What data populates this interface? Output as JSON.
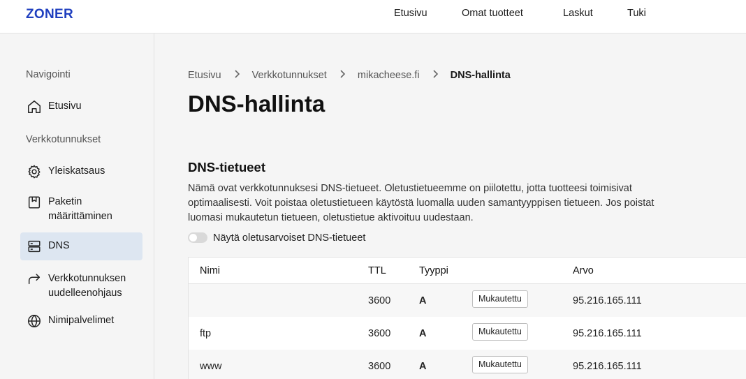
{
  "header": {
    "logo": "ZONER",
    "nav": [
      "Etusivu",
      "Omat tuotteet",
      "Laskut",
      "Tuki"
    ]
  },
  "sidebar": {
    "nav_heading": "Navigointi",
    "home": {
      "label": "Etusivu",
      "icon": "home-icon"
    },
    "domains_heading": "Verkkotunnukset",
    "items": [
      {
        "label": "Yleiskatsaus",
        "icon": "gear-icon",
        "active": false
      },
      {
        "label": "Paketin määrittäminen",
        "icon": "package-icon",
        "active": false
      },
      {
        "label": "DNS",
        "icon": "server-icon",
        "active": true
      },
      {
        "label": "Verkkotunnuksen uudelleenohjaus",
        "icon": "redirect-arrow-icon",
        "active": false
      },
      {
        "label": "Nimipalvelimet",
        "icon": "globe-icon",
        "active": false
      }
    ]
  },
  "breadcrumb": [
    "Etusivu",
    "Verkkotunnukset",
    "mikacheese.fi",
    "DNS-hallinta"
  ],
  "page_title": "DNS-hallinta",
  "section": {
    "title": "DNS-tietueet",
    "description": "Nämä ovat verkkotunnuksesi DNS-tietueet. Oletustietueemme on piilotettu, jotta tuotteesi toimisivat optimaalisesti. Voit poistaa oletustietueen käytöstä luomalla uuden samantyyppisen tietueen. Jos poistat luomasi mukautetun tietueen, oletustietue aktivoituu uudestaan.",
    "toggle_label": "Näytä oletusarvoiset DNS-tietueet",
    "toggle_on": false
  },
  "table": {
    "columns": {
      "name": "Nimi",
      "ttl": "TTL",
      "type": "Tyyppi",
      "value": "Arvo"
    },
    "rows": [
      {
        "name": "",
        "ttl": "3600",
        "type": "A",
        "badge": "Mukautettu",
        "value": "95.216.165.111"
      },
      {
        "name": "ftp",
        "ttl": "3600",
        "type": "A",
        "badge": "Mukautettu",
        "value": "95.216.165.111"
      },
      {
        "name": "www",
        "ttl": "3600",
        "type": "A",
        "badge": "Mukautettu",
        "value": "95.216.165.111"
      }
    ]
  },
  "colors": {
    "brand": "#1f3fbf",
    "active_bg": "#dde6f1"
  }
}
